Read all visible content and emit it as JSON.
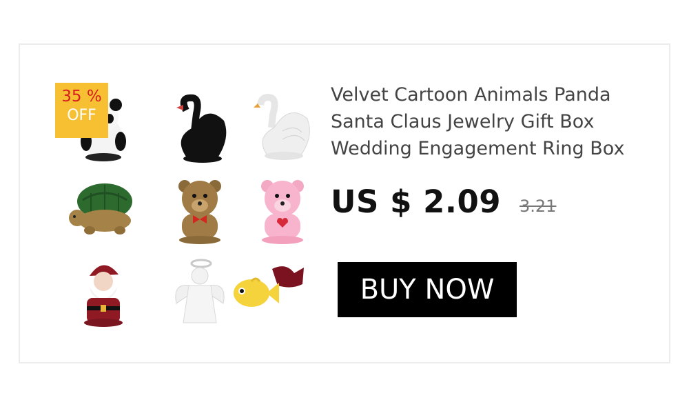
{
  "product": {
    "title": "Velvet Cartoon Animals Panda Santa Claus Jewelry Gift Box Wedding Engagement Ring Box",
    "price": "US $ 2.09",
    "old_price": "3.21",
    "discount_badge": {
      "percent": "35 %",
      "label": "OFF"
    },
    "buy_label": "BUY NOW",
    "images": [
      {
        "name": "panda-box-icon"
      },
      {
        "name": "black-swan-box-icon"
      },
      {
        "name": "white-swan-box-icon"
      },
      {
        "name": "turtle-box-icon"
      },
      {
        "name": "brown-bear-box-icon"
      },
      {
        "name": "pink-bear-box-icon"
      },
      {
        "name": "santa-box-icon"
      },
      {
        "name": "angel-box-icon"
      },
      {
        "name": "fish-box-icon"
      }
    ]
  },
  "colors": {
    "badge": "#f7c033",
    "badge_percent": "#d61e1e",
    "button": "#000000",
    "button_text": "#ffffff"
  }
}
